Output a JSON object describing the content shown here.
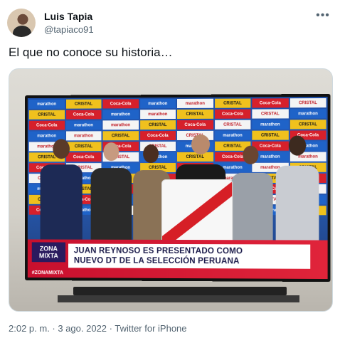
{
  "tweet": {
    "author_name": "Luis Tapia",
    "author_handle": "@tapiaco91",
    "more_icon": "more-icon",
    "text": "El que no conoce su historia…",
    "timestamp": "2:02 p. m. · 3 ago. 2022 · Twitter for iPhone"
  },
  "media": {
    "headline_line1": "JUAN REYNOSO ES PRESENTADO COMO",
    "headline_line2": "NUEVO DT DE LA SELECCIÓN PERUANA",
    "logo_line1": "ZONA",
    "logo_line2": "MIXTA",
    "hashtag": "#ZONAMIXTA",
    "sponsors": [
      "marathon",
      "CRISTAL",
      "Coca-Cola",
      "marathon",
      "marathon",
      "CRISTAL",
      "Coca-Cola",
      "CRISTAL"
    ]
  },
  "colors": {
    "accent": "#1d9bf0",
    "secondary_text": "#536471",
    "peru_red": "#d61f26"
  }
}
